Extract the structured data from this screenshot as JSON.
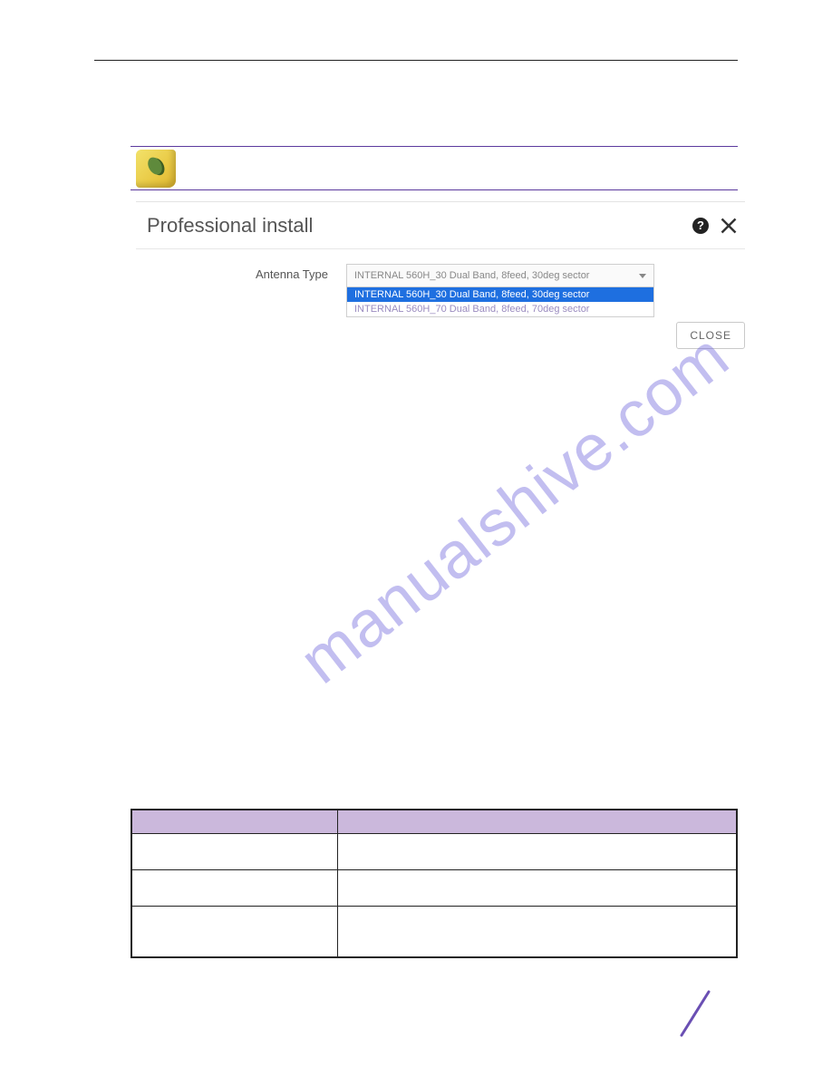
{
  "watermark": "manualshive.com",
  "dialog": {
    "title": "Professional install",
    "help_tooltip": "?",
    "antenna_label": "Antenna Type",
    "selected": "INTERNAL 560H_30 Dual Band, 8feed, 30deg sector",
    "options": [
      "INTERNAL 560H_30 Dual Band, 8feed, 30deg sector",
      "INTERNAL 560H_70 Dual Band, 8feed, 70deg sector"
    ],
    "close_button": "CLOSE"
  },
  "table": {
    "headers": [
      "",
      ""
    ],
    "rows": [
      [
        "",
        ""
      ],
      [
        "",
        ""
      ],
      [
        "",
        ""
      ]
    ]
  }
}
